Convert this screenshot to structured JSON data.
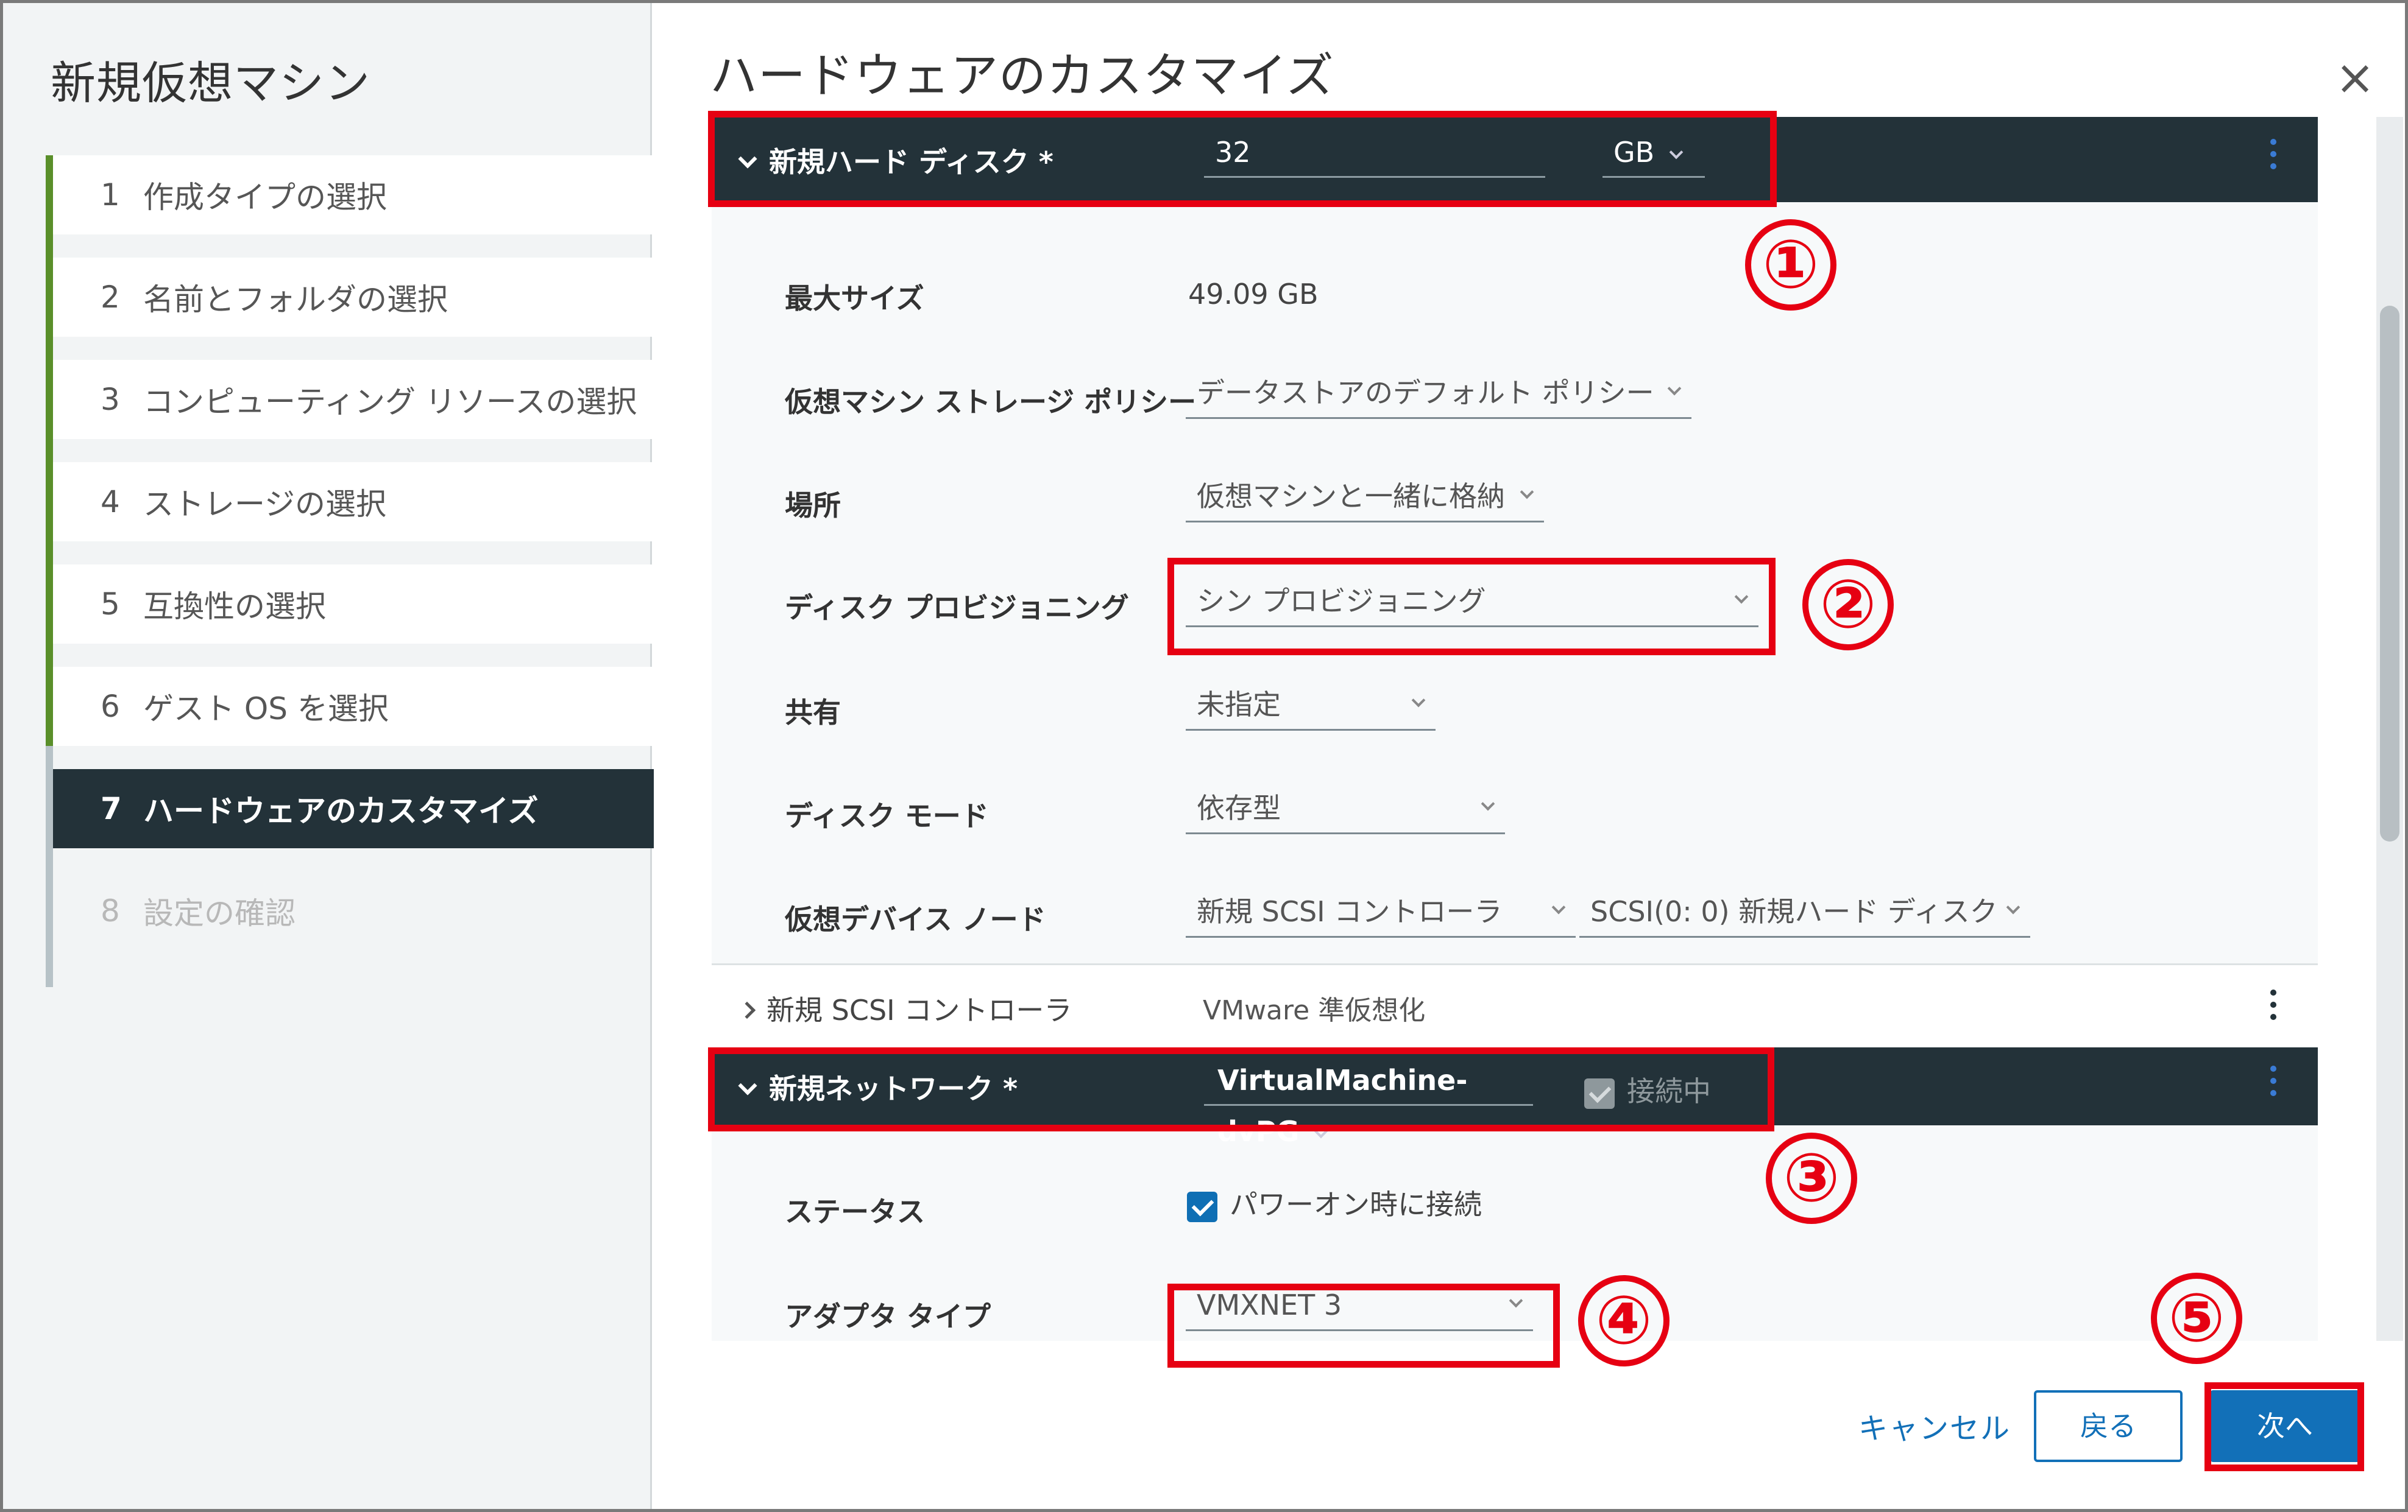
{
  "wizard": {
    "title": "新規仮想マシン",
    "steps": [
      {
        "num": "1",
        "label": "作成タイプの選択"
      },
      {
        "num": "2",
        "label": "名前とフォルダの選択"
      },
      {
        "num": "3",
        "label": "コンピューティング リソースの選択"
      },
      {
        "num": "4",
        "label": "ストレージの選択"
      },
      {
        "num": "5",
        "label": "互換性の選択"
      },
      {
        "num": "6",
        "label": "ゲスト OS を選択"
      },
      {
        "num": "7",
        "label": "ハードウェアのカスタマイズ"
      },
      {
        "num": "8",
        "label": "設定の確認"
      }
    ],
    "active_step": 7
  },
  "page": {
    "title": "ハードウェアのカスタマイズ",
    "close_icon": "×"
  },
  "hard_disk": {
    "header": "新規ハード ディスク *",
    "size_value": "32",
    "size_unit": "GB",
    "max_size_label": "最大サイズ",
    "max_size_value": "49.09 GB",
    "storage_policy_label": "仮想マシン ストレージ ポリシー",
    "storage_policy_value": "データストアのデフォルト ポリシー",
    "location_label": "場所",
    "location_value": "仮想マシンと一緒に格納",
    "provisioning_label": "ディスク プロビジョニング",
    "provisioning_value": "シン プロビジョニング",
    "sharing_label": "共有",
    "sharing_value": "未指定",
    "disk_mode_label": "ディスク モード",
    "disk_mode_value": "依存型",
    "device_node_label": "仮想デバイス ノード",
    "device_node_controller": "新規 SCSI コントローラ",
    "device_node_slot": "SCSI(0: 0) 新規ハード ディスク"
  },
  "scsi_controller": {
    "label": "新規 SCSI コントローラ",
    "value": "VMware 準仮想化"
  },
  "network": {
    "header": "新規ネットワーク *",
    "network_value": "VirtualMachine-dvPG",
    "connected_label": "接続中",
    "status_label": "ステータス",
    "power_on_connect_label": "パワーオン時に接続",
    "adapter_type_label": "アダプタ タイプ",
    "adapter_type_value": "VMXNET 3"
  },
  "annotations": [
    "①",
    "②",
    "③",
    "④",
    "⑤"
  ],
  "footer": {
    "cancel_label": "キャンセル",
    "back_label": "戻る",
    "next_label": "次へ"
  },
  "colors": {
    "dark_header": "#233239",
    "accent_blue": "#1270b8",
    "annotation_red": "#e60012",
    "step_done_green": "#5a8f2a"
  }
}
